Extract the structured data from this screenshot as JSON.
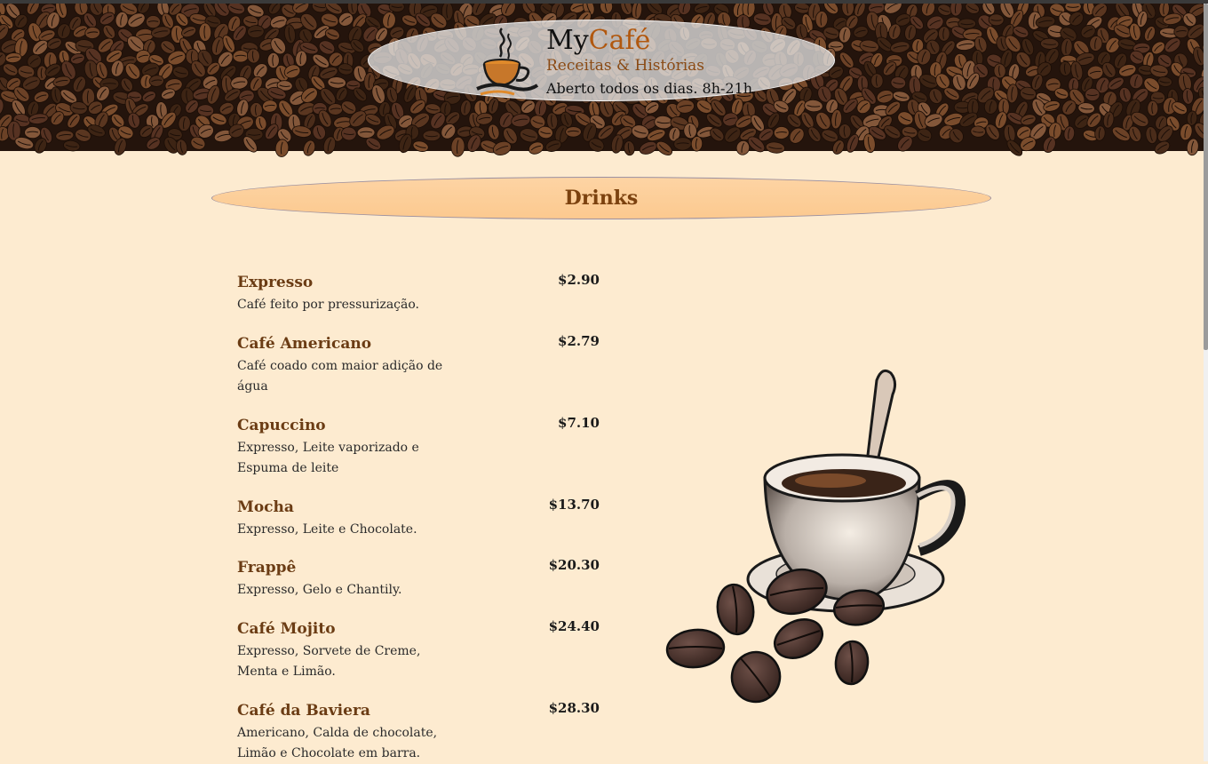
{
  "header": {
    "brand_prefix": "My",
    "brand_accent": "Café",
    "subtitle": "Receitas & Histórias",
    "hours": "Aberto todos os dias. 8h-21h",
    "logo_icon": "coffee-cup-steam-icon"
  },
  "section": {
    "title": "Drinks"
  },
  "menu": {
    "items": [
      {
        "name": "Expresso",
        "price": "$2.90",
        "description": "Café feito por pressurização."
      },
      {
        "name": "Café Americano",
        "price": "$2.79",
        "description": "Café coado com maior adição de água"
      },
      {
        "name": "Capuccino",
        "price": "$7.10",
        "description": "Expresso, Leite vaporizado e Espuma de leite"
      },
      {
        "name": "Mocha",
        "price": "$13.70",
        "description": "Expresso, Leite e Chocolate."
      },
      {
        "name": "Frappê",
        "price": "$20.30",
        "description": "Expresso, Gelo e Chantily."
      },
      {
        "name": "Café Mojito",
        "price": "$24.40",
        "description": "Expresso, Sorvete de Creme, Menta e Limão."
      },
      {
        "name": "Café da Baviera",
        "price": "$28.30",
        "description": "Americano, Calda de chocolate, Limão e Chocolate em barra."
      }
    ]
  },
  "illustration": {
    "icon": "coffee-cup-beans-illustration"
  },
  "colors": {
    "page_background": "#fdebd0",
    "heading_pill": "#fdd4a4",
    "brand_accent": "#b1580f",
    "item_name": "#6b3c14"
  }
}
